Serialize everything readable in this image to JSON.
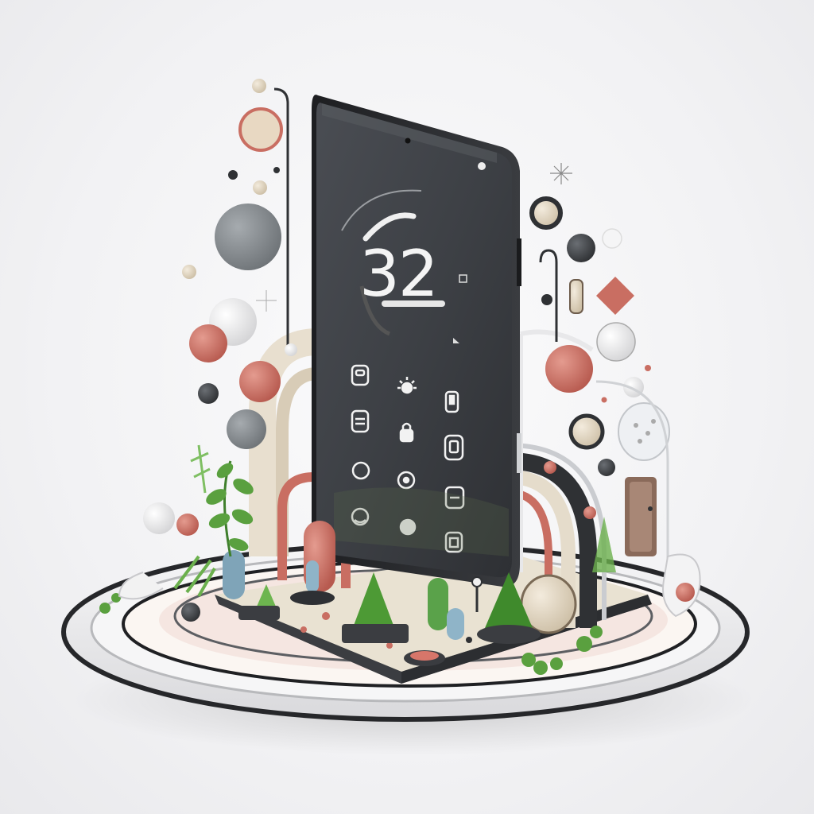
{
  "screen": {
    "clock_display": "32"
  },
  "palette": {
    "background": "#f3f3f5",
    "phone_body": "#2b2d31",
    "phone_screen": "#3e4146",
    "coral": "#c96e62",
    "beige": "#e6dccb",
    "sage_gray": "#8d9296",
    "leaf_green": "#4f9a3a",
    "chrome": "#c9ccd0"
  },
  "app_icons": [
    "message-icon",
    "sun-icon",
    "bottle-icon",
    "card-icon",
    "lock-icon",
    "square-app-icon",
    "circle-app-icon",
    "camera-icon",
    "slider-icon",
    "chat-bubble-icon",
    "record-icon",
    "shop-icon"
  ]
}
